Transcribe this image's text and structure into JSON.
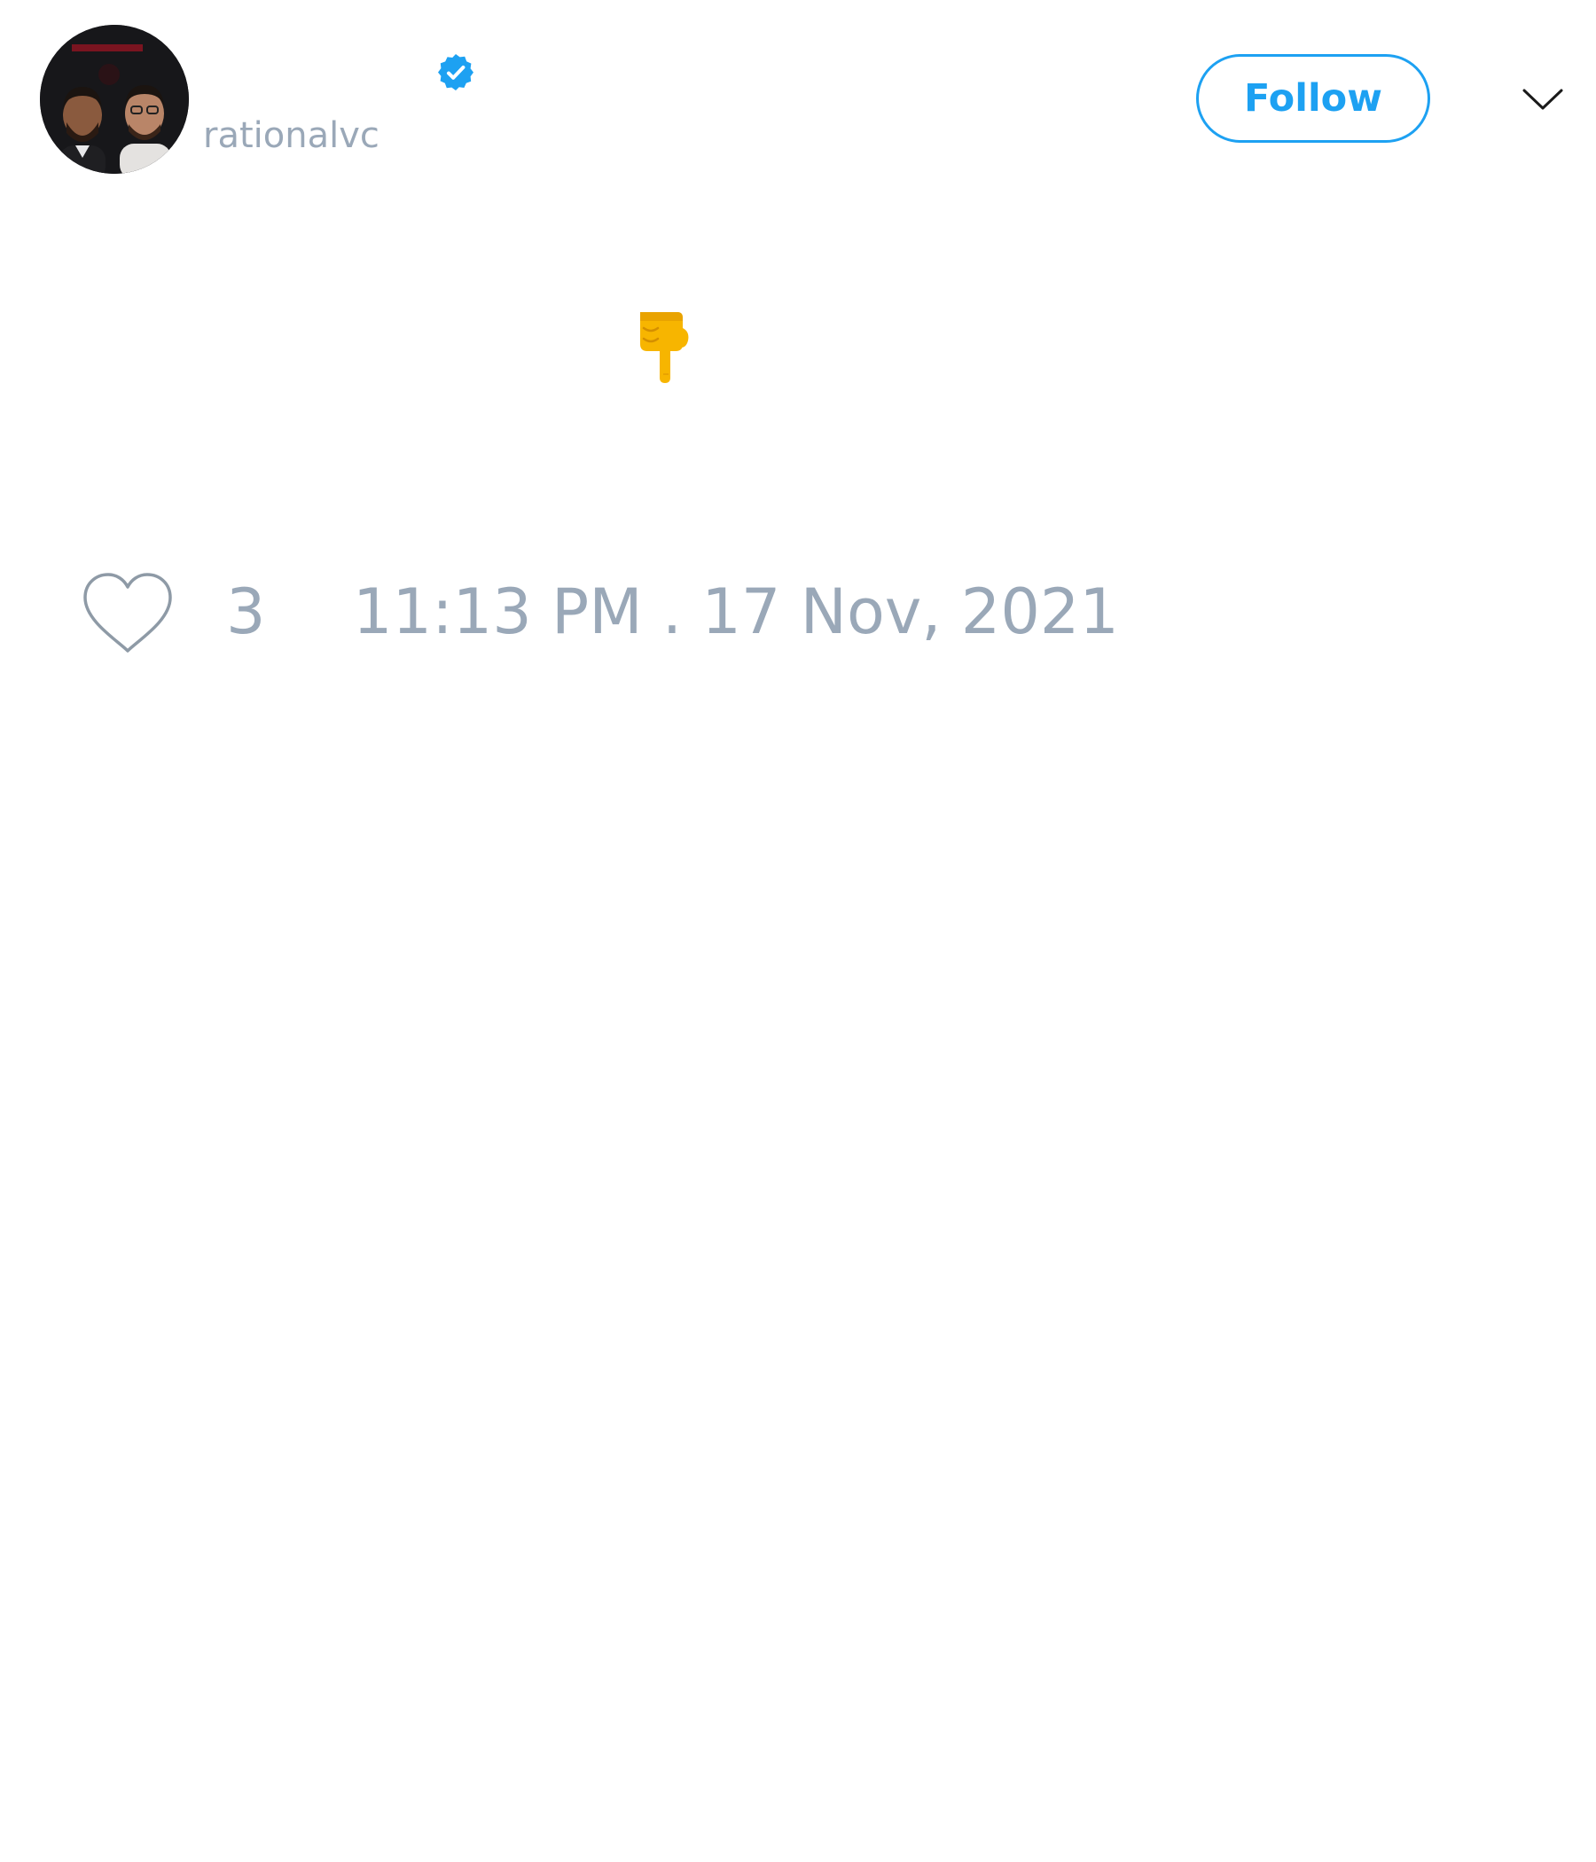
{
  "author": {
    "display_name": "",
    "handle": "rationalvc",
    "verified": true,
    "verified_color": "#1da1f2"
  },
  "actions": {
    "follow_label": "Follow",
    "more_menu_icon": "chevron-down-icon"
  },
  "tweet": {
    "text": "",
    "emoji": "backhand-index-pointing-down"
  },
  "footer": {
    "like_icon": "heart-outline-icon",
    "like_count": "3",
    "timestamp": "11:13 PM . 17 Nov, 2021"
  },
  "colors": {
    "accent": "#1da1f2",
    "muted_text": "#9aa8b8",
    "background": "#ffffff"
  }
}
